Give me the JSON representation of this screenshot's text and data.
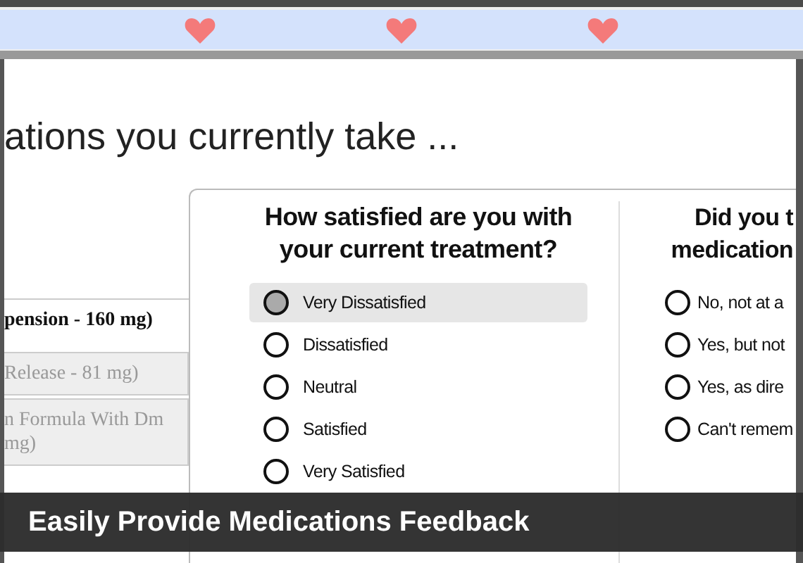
{
  "heading": "ations you currently take ...",
  "medications": [
    {
      "label": "pension - 160 mg)",
      "selected": true
    },
    {
      "label": "Release - 81 mg)",
      "selected": false
    },
    {
      "label": "n Formula With Dm mg)",
      "selected": false
    }
  ],
  "questions": [
    {
      "title_lines": [
        "How satisfied are you with",
        "your current treatment?"
      ],
      "options": [
        {
          "label": "Very Dissatisfied",
          "selected": true
        },
        {
          "label": "Dissatisfied",
          "selected": false
        },
        {
          "label": "Neutral",
          "selected": false
        },
        {
          "label": "Satisfied",
          "selected": false
        },
        {
          "label": "Very Satisfied",
          "selected": false
        }
      ]
    },
    {
      "title_lines": [
        "Did you t",
        "medication"
      ],
      "options": [
        {
          "label": "No, not at a",
          "selected": false
        },
        {
          "label": "Yes, but not",
          "selected": false
        },
        {
          "label": "Yes, as dire",
          "selected": false
        },
        {
          "label": "Can't remem",
          "selected": false
        }
      ]
    }
  ],
  "caption": "Easily Provide Medications Feedback"
}
